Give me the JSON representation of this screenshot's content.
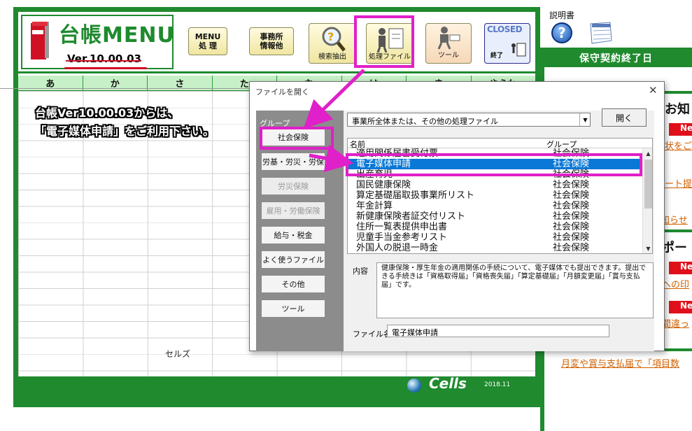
{
  "app": {
    "logo_title": "台帳MENU",
    "version": "Ver.10.00.03",
    "toolbar": [
      {
        "name": "menu-button",
        "label": "MENU\n処 理"
      },
      {
        "name": "office-info-button",
        "label": "事務所\n情報他"
      },
      {
        "name": "search-extract-button",
        "label": "検索抽出"
      },
      {
        "name": "process-file-button",
        "label": "処理ファイル"
      },
      {
        "name": "tool-button",
        "label": "ツール"
      },
      {
        "name": "exit-button",
        "label": "終了",
        "badge": "CLOSED"
      }
    ],
    "tabs": [
      "あ",
      "か",
      "さ",
      "た",
      "な",
      "は",
      "ま",
      "やらわ"
    ],
    "cell_label": "セルズ",
    "footer_brand": "Cells",
    "footer_date": "2018.11"
  },
  "right_panel": {
    "manual_label": "説明書",
    "title": "保守契約終了日",
    "notice_head": "お知",
    "support_head": "ポー",
    "badge": "Ne",
    "links": [
      "状をご",
      "ート提",
      "知らせ",
      "への印",
      "間違っ"
    ],
    "bottom_link": "月変や賞与支払届で「項目数"
  },
  "annotation": {
    "line1": "台帳Ver10.00.03からは、",
    "line2": "「電子媒体申請」をご利用下さい。"
  },
  "dialog": {
    "title": "ファイルを開く",
    "group_caption": "グループ",
    "groups": [
      {
        "label": "社会保険",
        "enabled": true
      },
      {
        "label": "労基・労災・労保",
        "enabled": true
      },
      {
        "label": "労災保険",
        "enabled": false
      },
      {
        "label": "雇用・労働保険",
        "enabled": false
      },
      {
        "label": "給与・税金",
        "enabled": true
      },
      {
        "label": "よく使うファイル",
        "enabled": true
      },
      {
        "label": "その他",
        "enabled": true
      },
      {
        "label": "ツール",
        "enabled": true
      }
    ],
    "combo_value": "事業所全体または、その他の処理ファイル",
    "open_button": "開く",
    "col_name": "名前",
    "col_group": "グループ",
    "files": [
      {
        "name": "適用関係届書受付票",
        "group": "社会保険"
      },
      {
        "name": "電子媒体申請",
        "group": "社会保険"
      },
      {
        "name": "出産育児",
        "group": "社会保険"
      },
      {
        "name": "国民健康保険",
        "group": "社会保険"
      },
      {
        "name": "算定基礎届取扱事業所リスト",
        "group": "社会保険"
      },
      {
        "name": "年金計算",
        "group": "社会保険"
      },
      {
        "name": "新健康保険者証交付リスト",
        "group": "社会保険"
      },
      {
        "name": "住所一覧表提供申出書",
        "group": "社会保険"
      },
      {
        "name": "児童手当金参考リスト",
        "group": "社会保険"
      },
      {
        "name": "外国人の脱退一時金",
        "group": "社会保険"
      }
    ],
    "selected_index": 1,
    "desc_label": "内容",
    "description": "健康保険・厚生年金の適用関係の手続について、電子媒体でも提出できます。提出できる手続きは「資格取得届」「資格喪失届」「算定基礎届」「月額変更届」「賞与支払届」です。",
    "filename_label": "ファイル名",
    "filename_value": "電子媒体申請"
  },
  "colors": {
    "brand_green": "#1f8a2e",
    "highlight_magenta": "#e020c8",
    "selection_blue": "#0a78d7",
    "badge_red": "#e0101a"
  }
}
